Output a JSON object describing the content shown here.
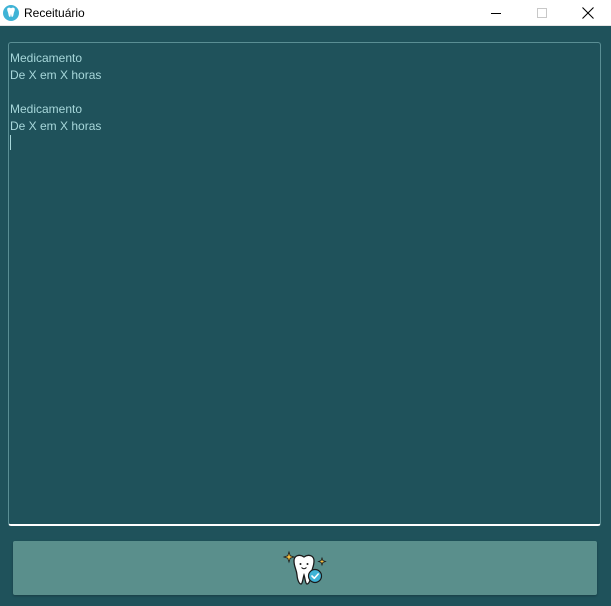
{
  "window": {
    "title": "Receituário",
    "app_icon": "tooth-icon",
    "controls": [
      "minimize-icon",
      "maximize-icon",
      "close-icon"
    ]
  },
  "editor": {
    "lines": [
      "Medicamento",
      "De X em X horas",
      "",
      "Medicamento",
      "De X em X horas",
      ""
    ]
  },
  "action_button": {
    "icon": "sparkling-tooth-check-icon"
  },
  "colors": {
    "background": "#1f525b",
    "text": "#a7d7da",
    "button": "#5a8f8c",
    "editor_border": "#5a8e94",
    "accent": "#3fb3d6"
  }
}
